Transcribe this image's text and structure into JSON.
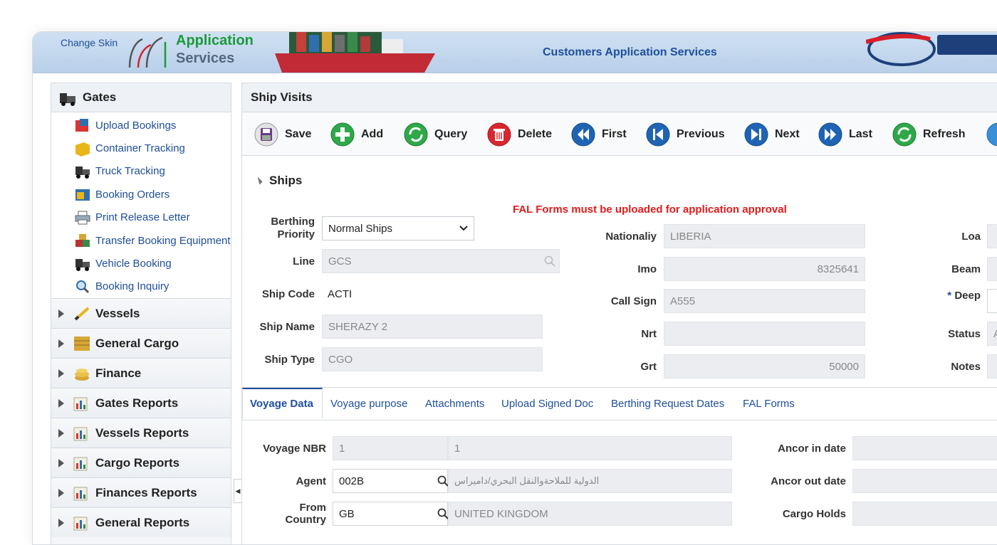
{
  "header": {
    "change_skin": "Change Skin",
    "app_title_line1": "Application",
    "app_title_line2": "Services",
    "center_title": "Customers Application Services"
  },
  "sidebar": {
    "gates": {
      "label": "Gates",
      "items": [
        {
          "label": "Upload Bookings",
          "icon": "upload-bookings-icon"
        },
        {
          "label": "Container Tracking",
          "icon": "container-icon"
        },
        {
          "label": "Truck Tracking",
          "icon": "truck-icon"
        },
        {
          "label": "Booking Orders",
          "icon": "booking-orders-icon"
        },
        {
          "label": "Print Release Letter",
          "icon": "printer-icon"
        },
        {
          "label": "Transfer Booking Equipment",
          "icon": "transfer-icon"
        },
        {
          "label": "Vehicle Booking",
          "icon": "vehicle-icon"
        },
        {
          "label": "Booking Inquiry",
          "icon": "magnifier-icon"
        }
      ]
    },
    "sections": [
      {
        "label": "Vessels",
        "icon": "vessels-icon"
      },
      {
        "label": "General Cargo",
        "icon": "cargo-icon"
      },
      {
        "label": "Finance",
        "icon": "finance-icon"
      },
      {
        "label": "Gates Reports",
        "icon": "report-icon"
      },
      {
        "label": "Vessels Reports",
        "icon": "report-icon"
      },
      {
        "label": "Cargo Reports",
        "icon": "report-icon"
      },
      {
        "label": "Finances Reports",
        "icon": "report-icon"
      },
      {
        "label": "General Reports",
        "icon": "report-icon"
      }
    ]
  },
  "main": {
    "title": "Ship Visits",
    "toolbar": {
      "save": "Save",
      "add": "Add",
      "query": "Query",
      "delete": "Delete",
      "first": "First",
      "previous": "Previous",
      "next": "Next",
      "last": "Last",
      "refresh": "Refresh"
    },
    "ships": {
      "section_label": "Ships",
      "warning": "FAL Forms must be uploaded for application approval",
      "berthing_priority_label_1": "Berthing",
      "berthing_priority_label_2": "Priority",
      "berthing_priority_value": "Normal Ships",
      "line_label": "Line",
      "line_value": "GCS",
      "ship_code_label": "Ship Code",
      "ship_code_value": "ACTI",
      "ship_name_label": "Ship Name",
      "ship_name_value": "SHERAZY 2",
      "ship_type_label": "Ship Type",
      "ship_type_value": "CGO",
      "nationality_label": "Nationaliy",
      "nationality_value": "LIBERIA",
      "imo_label": "Imo",
      "imo_value": "8325641",
      "call_sign_label": "Call Sign",
      "call_sign_value": "A555",
      "nrt_label": "Nrt",
      "nrt_value": "",
      "grt_label": "Grt",
      "grt_value": "50000",
      "loa_label": "Loa",
      "beam_label": "Beam",
      "deep_label": "Deep",
      "deep_required": "*",
      "status_label": "Status",
      "status_value": "A",
      "notes_label": "Notes"
    },
    "tabs": [
      "Voyage Data",
      "Voyage purpose",
      "Attachments",
      "Upload Signed Doc",
      "Berthing Request Dates",
      "FAL Forms"
    ],
    "voyage": {
      "voyage_nbr_label": "Voyage NBR",
      "voyage_nbr_value": "1",
      "voyage_nbr_value2": "1",
      "agent_label": "Agent",
      "agent_code": "002B",
      "agent_name": "الدولية للملاحةوالنقل البحري/داميراس",
      "from_country_label_1": "From",
      "from_country_label_2": "Country",
      "from_country_code": "GB",
      "from_country_name": "UNITED KINGDOM",
      "ancor_in_label": "Ancor in date",
      "ancor_out_label": "Ancor out date",
      "cargo_holds_label": "Cargo Holds"
    }
  }
}
